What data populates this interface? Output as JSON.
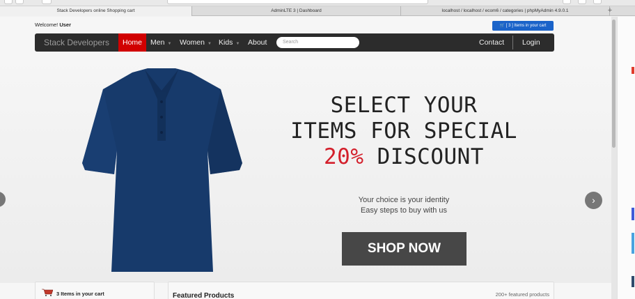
{
  "browser": {
    "tabs": [
      {
        "title": "Stack Developers online Shopping cart",
        "active": true
      },
      {
        "title": "AdminLTE 3 | Dashboard",
        "active": false
      },
      {
        "title": "localhost / localhost / ecom6 / categories | phpMyAdmin 4.9.0.1",
        "active": false
      }
    ],
    "new_tab": "+"
  },
  "header": {
    "welcome": "Welcome!",
    "user": "User",
    "cart_button": "[ 3 ] Items in your cart"
  },
  "nav": {
    "brand": "Stack Developers",
    "items": [
      {
        "label": "Home",
        "active": true,
        "dropdown": false
      },
      {
        "label": "Men",
        "active": false,
        "dropdown": true
      },
      {
        "label": "Women",
        "active": false,
        "dropdown": true
      },
      {
        "label": "Kids",
        "active": false,
        "dropdown": true
      },
      {
        "label": "About",
        "active": false,
        "dropdown": false
      }
    ],
    "search_placeholder": "Search",
    "contact": "Contact",
    "login": "Login"
  },
  "hero": {
    "line1": "SELECT YOUR",
    "line2": "ITEMS FOR SPECIAL",
    "line3_highlight": "20%",
    "line3_rest": " DISCOUNT",
    "sub1": "Your choice is your identity",
    "sub2": "Easy steps to buy with us",
    "button": "SHOP NOW",
    "arrow_right": "›"
  },
  "sidebar": {
    "cart_text": "3 Items in your cart"
  },
  "featured": {
    "title": "Featured Products",
    "count": "200+ featured products"
  },
  "colors": {
    "nav_bg": "#2c2c2c",
    "active_red": "#d10000",
    "cart_blue": "#1a63c9",
    "shirt": "#173a6b",
    "highlight": "#d31f2b"
  }
}
